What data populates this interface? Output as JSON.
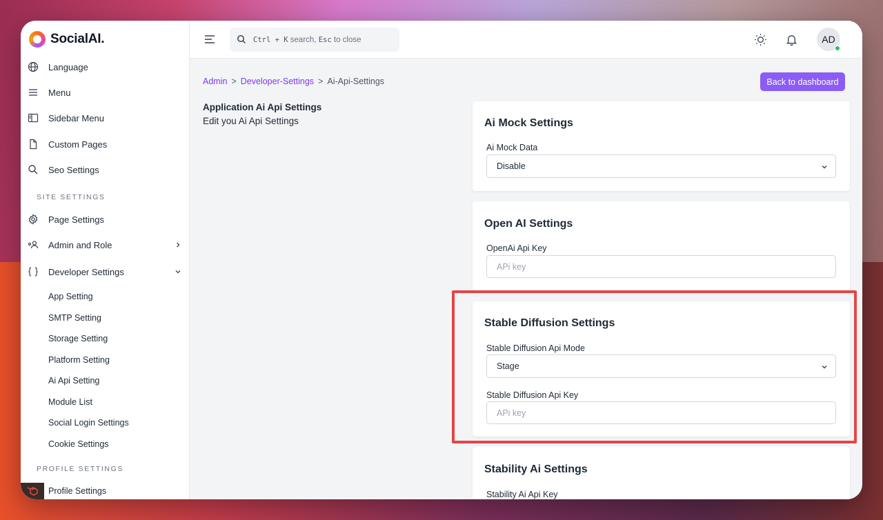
{
  "app": {
    "brand": "SocialAI."
  },
  "sidebar": {
    "items": [
      {
        "label": "Language",
        "icon": "globe-icon"
      },
      {
        "label": "Menu",
        "icon": "menu-icon"
      },
      {
        "label": "Sidebar Menu",
        "icon": "sidebar-layout-icon"
      },
      {
        "label": "Custom Pages",
        "icon": "file-icon"
      },
      {
        "label": "Seo Settings",
        "icon": "search-icon"
      }
    ],
    "site_settings_title": "SITE SETTINGS",
    "site_items": [
      {
        "label": "Page Settings",
        "icon": "gear-icon"
      },
      {
        "label": "Admin and Role",
        "icon": "users-icon"
      },
      {
        "label": "Developer Settings",
        "icon": "braces-icon"
      }
    ],
    "developer_sub_items": [
      "App Setting",
      "SMTP Setting",
      "Storage Setting",
      "Platform Setting",
      "Ai Api Setting",
      "Module List",
      "Social Login Settings",
      "Cookie Settings"
    ],
    "profile_settings_title": "PROFILE SETTINGS",
    "profile_item": "Profile Settings"
  },
  "topbar": {
    "search_kbd1": "Ctrl + K",
    "search_text1": "search,",
    "search_kbd2": "Esc",
    "search_text2": "to close",
    "avatar_initials": "AD"
  },
  "breadcrumb": {
    "root": "Admin",
    "sep": ">",
    "middle": "Developer-Settings",
    "current": "Ai-Api-Settings"
  },
  "header": {
    "back_button": "Back to dashboard",
    "title": "Application Ai Api Settings",
    "subtitle": "Edit you Ai Api Settings"
  },
  "cards": {
    "mock": {
      "title": "Ai Mock Settings",
      "field_label": "Ai Mock Data",
      "value": "Disable"
    },
    "openai": {
      "title": "Open AI Settings",
      "field_label": "OpenAi Api Key",
      "placeholder": "APi key"
    },
    "stable": {
      "title": "Stable Diffusion Settings",
      "mode_label": "Stable Diffusion Api Mode",
      "mode_value": "Stage",
      "key_label": "Stable Diffusion Api Key",
      "key_placeholder": "APi key"
    },
    "stability": {
      "title": "Stability Ai Settings",
      "field_label": "Stability Ai Api Key"
    }
  },
  "colors": {
    "accent": "#8b5cf6",
    "highlight": "#e54545",
    "online": "#22c55e"
  }
}
